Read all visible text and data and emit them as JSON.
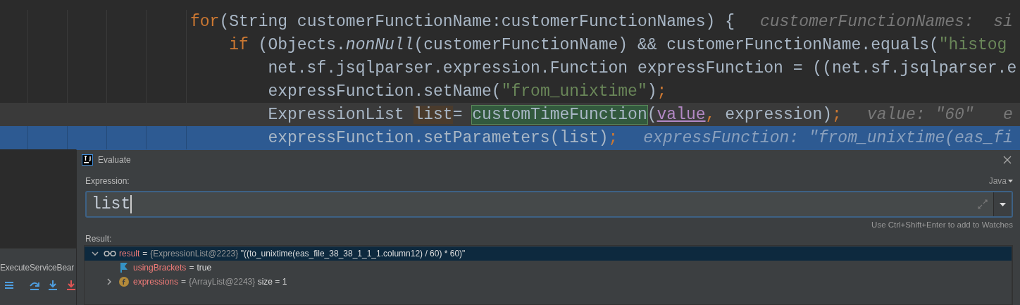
{
  "editor": {
    "lines": [
      {
        "current": false,
        "selected": false,
        "segments": [
          {
            "kind": "keyword",
            "text": "for"
          },
          {
            "kind": "plain",
            "text": "(String customerFunctionName:customerFunctionNames) {"
          }
        ],
        "hint": "customerFunctionNames:  si",
        "children": [
          {
            "current": false,
            "selected": false,
            "segments": [
              {
                "kind": "keyword",
                "text": "if"
              },
              {
                "kind": "plain",
                "text": " (Objects."
              },
              {
                "kind": "static",
                "text": "nonNull"
              },
              {
                "kind": "plain",
                "text": "(customerFunctionName) && customerFunctionName.equals("
              },
              {
                "kind": "string",
                "text": "\"histog"
              }
            ],
            "children": [
              {
                "current": false,
                "selected": false,
                "segments": [
                  {
                    "kind": "plain",
                    "text": "net.sf.jsqlparser.expression.Function expressFunction = ((net.sf.jsqlparser.e"
                  }
                ]
              },
              {
                "current": false,
                "selected": false,
                "segments": [
                  {
                    "kind": "plain",
                    "text": "expressFunction.setName("
                  },
                  {
                    "kind": "string",
                    "text": "\"from_unixtime\""
                  },
                  {
                    "kind": "plain",
                    "text": ")"
                  },
                  {
                    "kind": "punct",
                    "text": ";"
                  }
                ]
              },
              {
                "current": true,
                "selected": false,
                "segments": [
                  {
                    "kind": "plain",
                    "text": "ExpressionList "
                  },
                  {
                    "kind": "usage",
                    "text": "list"
                  },
                  {
                    "kind": "plain",
                    "text": "= "
                  },
                  {
                    "kind": "match",
                    "text": "customTimeFunction"
                  },
                  {
                    "kind": "plain",
                    "text": "("
                  },
                  {
                    "kind": "param",
                    "text": "value"
                  },
                  {
                    "kind": "punct",
                    "text": ","
                  },
                  {
                    "kind": "plain",
                    "text": " expression)"
                  },
                  {
                    "kind": "punct",
                    "text": ";"
                  }
                ],
                "hint": "value: \"60\"   e"
              },
              {
                "current": false,
                "selected": true,
                "segments": [
                  {
                    "kind": "plain",
                    "text": "expressFunction.setParameters(list)"
                  },
                  {
                    "kind": "punct",
                    "text": ";"
                  }
                ],
                "hint": "expressFunction: \"from_unixtime(eas_fi"
              }
            ]
          }
        ]
      }
    ]
  },
  "debug_panel": {
    "tab": "ExecuteServiceBear",
    "tools": [
      {
        "kind": "menu"
      },
      {
        "kind": "step-over"
      },
      {
        "kind": "step-into"
      },
      {
        "kind": "force-step-into"
      }
    ]
  },
  "dialog": {
    "title": "Evaluate",
    "expression_label": "Expression:",
    "language": "Java",
    "expression": {
      "value": "list"
    },
    "hint": "Use Ctrl+Shift+Enter to add to Watches",
    "result_label": "Result:",
    "tree": [
      {
        "kind": "watch",
        "name": "result",
        "operator": "=",
        "type_info": "{ExpressionList@2223}",
        "value": "\"((to_unixtime(eas_file_38_38_1_1_1.column12) / 60) * 60)\"",
        "expanded": true,
        "selected": true,
        "children": [
          {
            "kind": "flag",
            "name": "usingBrackets",
            "operator": "=",
            "value": "true",
            "selected": false
          },
          {
            "kind": "field",
            "name": "expressions",
            "operator": "=",
            "type_info": "{ArrayList@2243}",
            "value": "size = 1",
            "expanded": false,
            "selected": false
          }
        ]
      }
    ]
  }
}
